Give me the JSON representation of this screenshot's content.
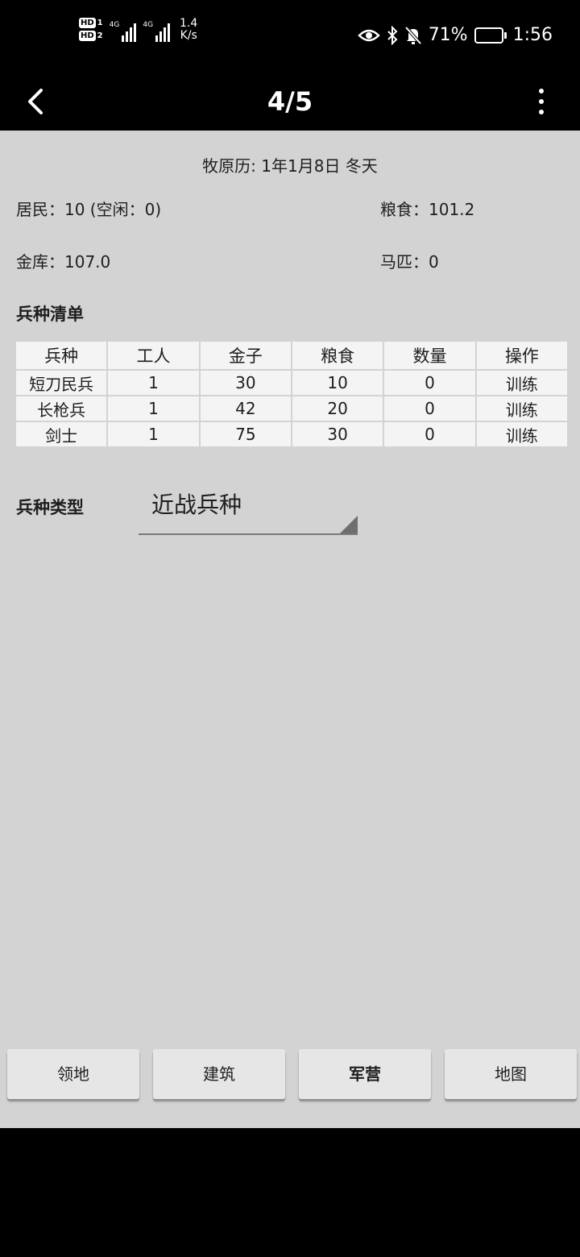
{
  "status_bar": {
    "hd1": "HD",
    "hd1_sim": "1",
    "hd2": "HD",
    "hd2_sim": "2",
    "net1": "4G",
    "net2": "4G",
    "speed_value": "1.4",
    "speed_unit": "K/s",
    "battery_text": "71%",
    "battery_level": 0.71,
    "time": "1:56"
  },
  "app_bar": {
    "title": "4/5"
  },
  "main": {
    "date": "牧原历: 1年1月8日  冬天",
    "residents": "居民：10 (空闲：0)",
    "food": "粮食：101.2",
    "treasury": "金库：107.0",
    "horses": "马匹：0"
  },
  "unit_list": {
    "title": "兵种清单",
    "headers": [
      "兵种",
      "工人",
      "金子",
      "粮食",
      "数量",
      "操作"
    ],
    "rows": [
      [
        "短刀民兵",
        "1",
        "30",
        "10",
        "0",
        "训练"
      ],
      [
        "长枪兵",
        "1",
        "42",
        "20",
        "0",
        "训练"
      ],
      [
        "剑士",
        "1",
        "75",
        "30",
        "0",
        "训练"
      ]
    ]
  },
  "unit_type": {
    "label": "兵种类型",
    "selected": "近战兵种"
  },
  "nav": {
    "items": [
      {
        "label": "领地",
        "active": false
      },
      {
        "label": "建筑",
        "active": false
      },
      {
        "label": "军营",
        "active": true
      },
      {
        "label": "地图",
        "active": false
      }
    ]
  }
}
